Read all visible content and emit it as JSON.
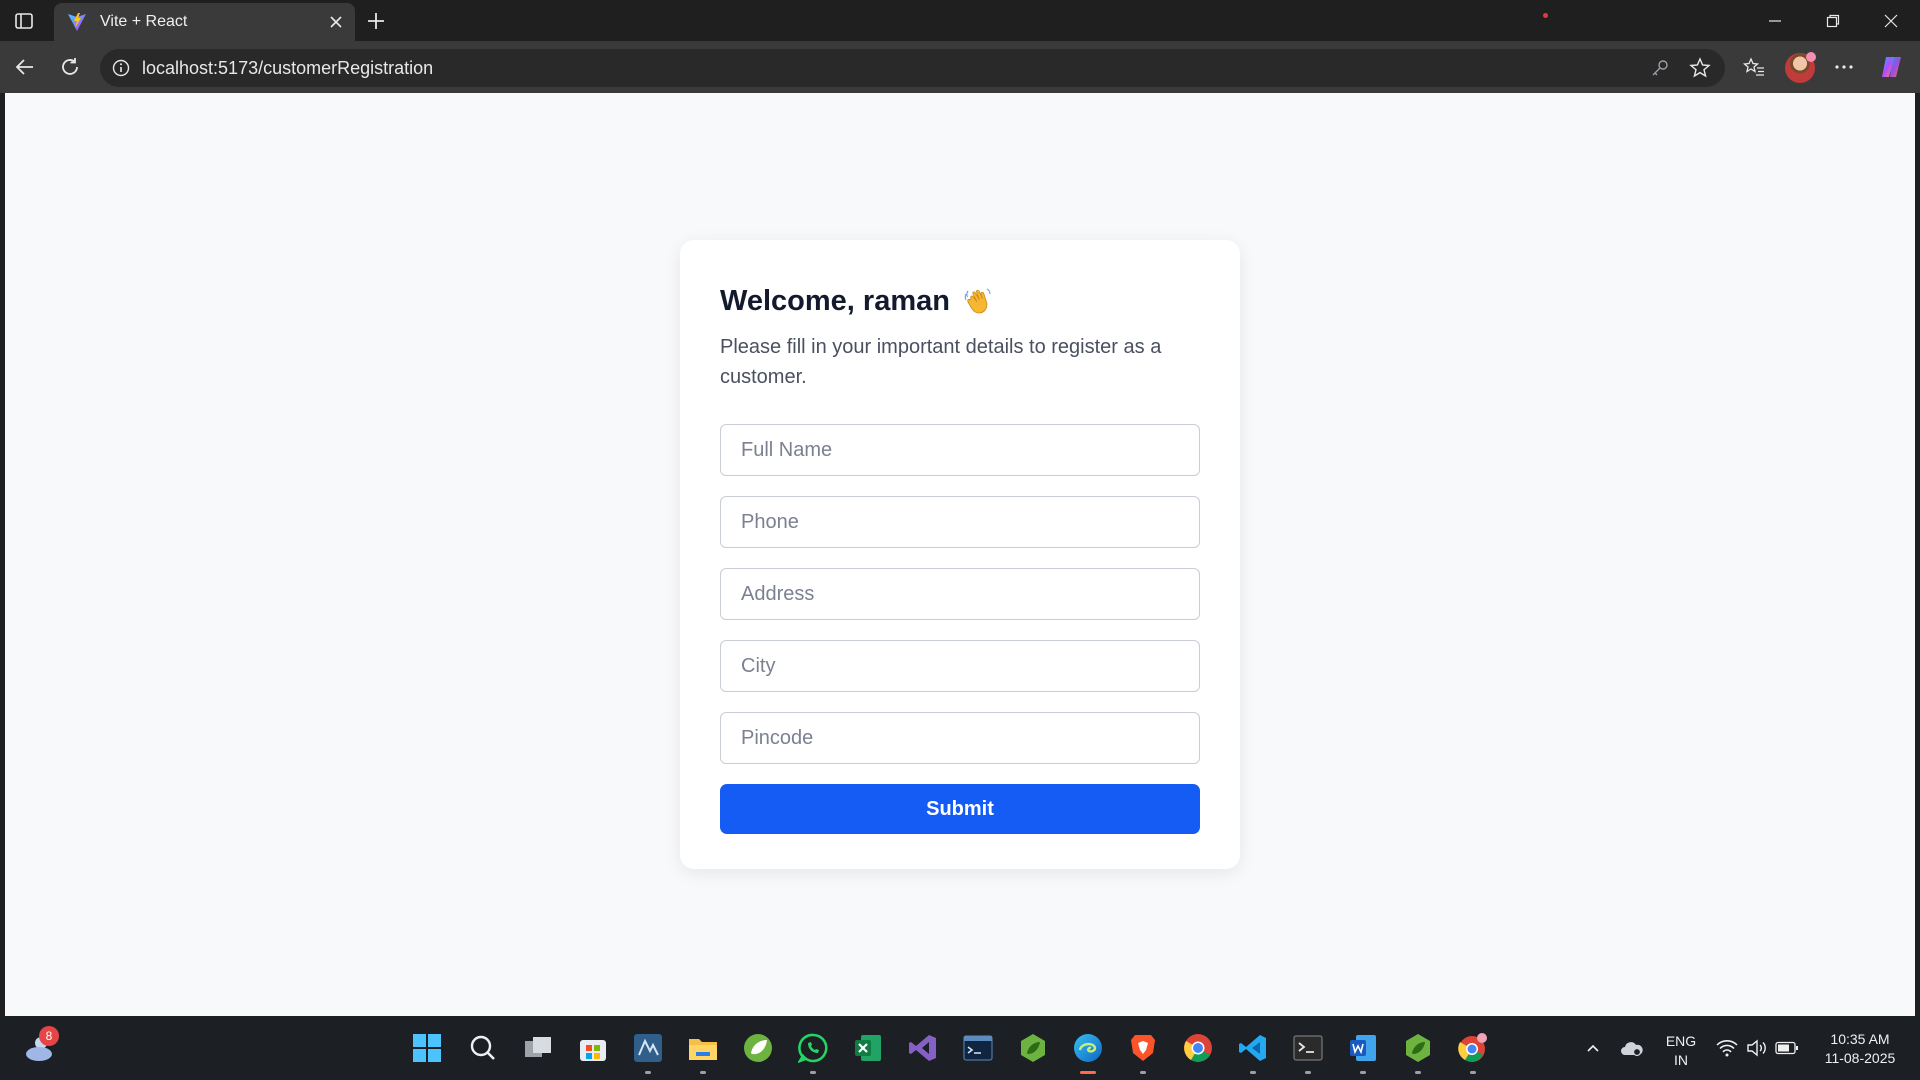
{
  "browser": {
    "tab_title": "Vite + React",
    "url": "localhost:5173/customerRegistration"
  },
  "page": {
    "heading": "Welcome, raman",
    "heading_emoji": "waving-hand",
    "subtitle": "Please fill in your important details to register as a customer.",
    "fields": {
      "full_name": {
        "placeholder": "Full Name",
        "value": ""
      },
      "phone": {
        "placeholder": "Phone",
        "value": ""
      },
      "address": {
        "placeholder": "Address",
        "value": ""
      },
      "city": {
        "placeholder": "City",
        "value": ""
      },
      "pincode": {
        "placeholder": "Pincode",
        "value": ""
      }
    },
    "submit_label": "Submit",
    "colors": {
      "accent": "#155cf5",
      "card": "#ffffff",
      "background": "#f8f9fb"
    }
  },
  "taskbar": {
    "weather_badge": "8",
    "language": "ENG",
    "region": "IN",
    "time": "10:35 AM",
    "date": "11-08-2025",
    "apps": [
      "start-icon",
      "search-icon",
      "task-view-icon",
      "microsoft-store-icon",
      "mysql-workbench-icon",
      "file-explorer-icon",
      "spring-tool-icon",
      "whatsapp-icon",
      "excel-icon",
      "visual-studio-icon",
      "mysql-shell-icon",
      "spring-boot-icon",
      "edge-icon",
      "brave-icon",
      "chrome-icon",
      "vscode-icon",
      "terminal-icon",
      "word-icon",
      "spring-leaf-icon",
      "chrome-profile-icon"
    ]
  }
}
